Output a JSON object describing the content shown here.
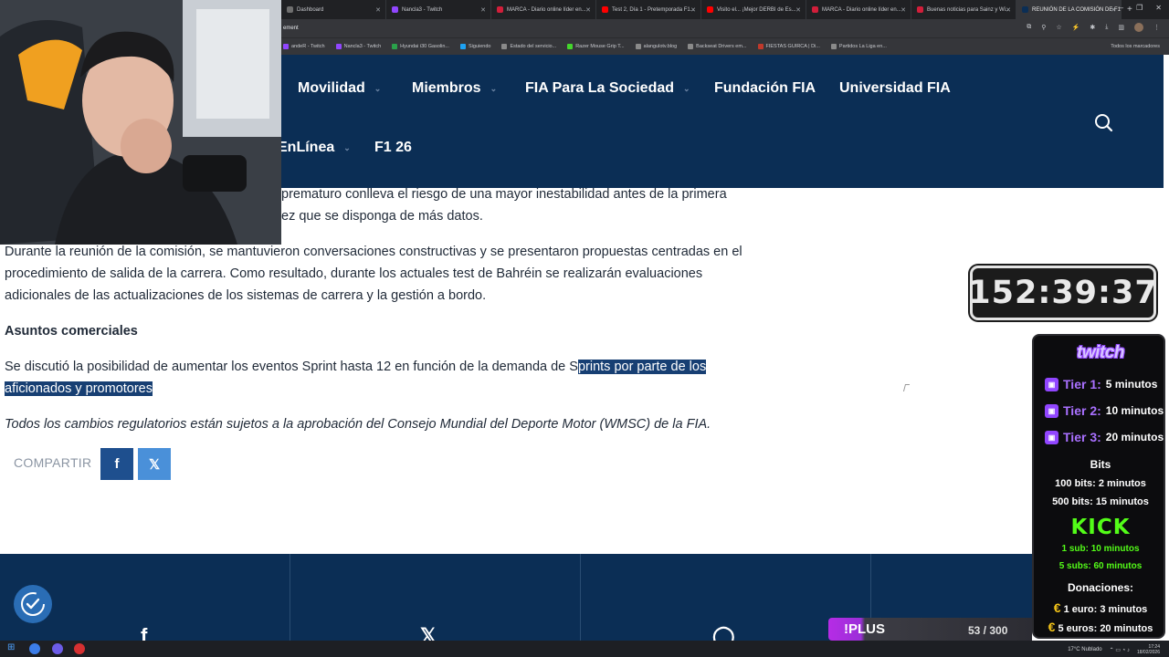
{
  "browser": {
    "tabs": [
      {
        "label": "Dashboard",
        "favicon_color": "#6f6f6f",
        "active": false
      },
      {
        "label": "Nancla3 - Twitch",
        "favicon_color": "#9146ff",
        "active": false
      },
      {
        "label": "MARCA - Diario online líder en...",
        "favicon_color": "#d21e3a",
        "active": false
      },
      {
        "label": "Test 2, Día 1 - Pretemporada F1...",
        "favicon_color": "#ff0000",
        "active": false
      },
      {
        "label": "Visito el... ¡Mejor DERBI de Es...",
        "favicon_color": "#ff0000",
        "active": false
      },
      {
        "label": "MARCA - Diario online líder en...",
        "favicon_color": "#d21e3a",
        "active": false
      },
      {
        "label": "Buenas noticias para Sainz y Wi...",
        "favicon_color": "#d21e3a",
        "active": false
      },
      {
        "label": "REUNIÓN DE LA COMISIÓN DE F1...",
        "favicon_color": "#0b2e55",
        "active": true
      }
    ],
    "new_tab": "+",
    "window_controls": [
      "–",
      "❐",
      "✕"
    ],
    "url": "ement",
    "bookmarks": [
      {
        "label": "andeR - Twitch",
        "color": "#9146ff"
      },
      {
        "label": "Nancla3 - Twitch",
        "color": "#9146ff"
      },
      {
        "label": "Hyundai i30 Gasolin...",
        "color": "#2aa04a"
      },
      {
        "label": "Siguiendo",
        "color": "#1da1f2"
      },
      {
        "label": "Estado del servicio...",
        "color": "#8a8a8a"
      },
      {
        "label": "Razer Mouse Grip T...",
        "color": "#44d62c"
      },
      {
        "label": "alangulotv.blog",
        "color": "#8a8a8a"
      },
      {
        "label": "Backseat Drivers em...",
        "color": "#8a8a8a"
      },
      {
        "label": "FIESTAS GUIRCA | Di...",
        "color": "#c0392b"
      },
      {
        "label": "Partidos La Liga en...",
        "color": "#8a8a8a"
      }
    ],
    "all_bookmarks": "Todos los marcadores"
  },
  "fia_nav": {
    "row1": [
      {
        "label": "Movilidad",
        "dropdown": true
      },
      {
        "label": "Miembros",
        "dropdown": true
      },
      {
        "label": "FIA Para La Sociedad",
        "dropdown": true
      },
      {
        "label": "Fundación FIA",
        "dropdown": false
      },
      {
        "label": "Universidad FIA",
        "dropdown": false
      }
    ],
    "row2": [
      {
        "label": "EnLínea",
        "dropdown": true
      },
      {
        "label": "F1 26",
        "dropdown": false
      }
    ]
  },
  "article": {
    "p1_line1": "prematuro conlleva el riesgo de una mayor inestabilidad antes de la primera",
    "p1_line2": "ez que se disponga de más datos.",
    "p2_line1": "Durante la reunión de la comisión, se mantuvieron conversaciones constructivas y se presentaron propuestas centradas en el",
    "p2_line2": "procedimiento de salida de la carrera. Como resultado, durante los actuales test de Bahréin se realizarán evaluaciones",
    "p2_line3": "adicionales de las actualizaciones de los sistemas de carrera y la gestión a bordo.",
    "heading": "Asuntos comerciales",
    "p3_line1_plain": "Se discutió la posibilidad de aumentar los eventos Sprint hasta 12 en función de la demanda de S",
    "p3_line1_selected": "prints por parte de los",
    "p3_line2_selected": "aficionados y promotores",
    "note": "Todos los cambios regulatorios están sujetos a la aprobación del Consejo Mundial del Deporte Motor (WMSC) de la FIA."
  },
  "share": {
    "label": "COMPARTIR",
    "facebook": "f",
    "x": "𝕏",
    "facebook_color": "#1e4f8e",
    "x_color": "#4a90d9"
  },
  "footer": {
    "icons": [
      "f",
      "𝕏",
      "◯"
    ]
  },
  "timer": {
    "value": "152:39:37"
  },
  "sub_panel": {
    "twitch_title": "twitch",
    "tiers": [
      {
        "name": "Tier 1:",
        "time": "5 minutos"
      },
      {
        "name": "Tier 2:",
        "time": "10 minutos"
      },
      {
        "name": "Tier 3:",
        "time": "20 minutos"
      }
    ],
    "bits_title": "Bits",
    "bits": [
      {
        "amount": "100 bits:",
        "time": "2 minutos"
      },
      {
        "amount": "500 bits:",
        "time": "15 minutos"
      }
    ],
    "kick_title": "KICK",
    "kick": [
      {
        "amount": "1 sub:",
        "time": "10 minutos"
      },
      {
        "amount": "5 subs:",
        "time": "60 minutos"
      }
    ],
    "donations_title": "Donaciones:",
    "donations": [
      {
        "amount": "1 euro:",
        "time": "3 minutos"
      },
      {
        "amount": "5 euros:",
        "time": "20 minutos"
      }
    ],
    "euro_symbol": "€"
  },
  "plus_bar": {
    "label": "!PLUS",
    "count": "53 / 300",
    "progress": 0.18
  },
  "taskbar": {
    "weather": "17°C  Nublado",
    "time": "17:24",
    "date": "18/02/2026"
  }
}
